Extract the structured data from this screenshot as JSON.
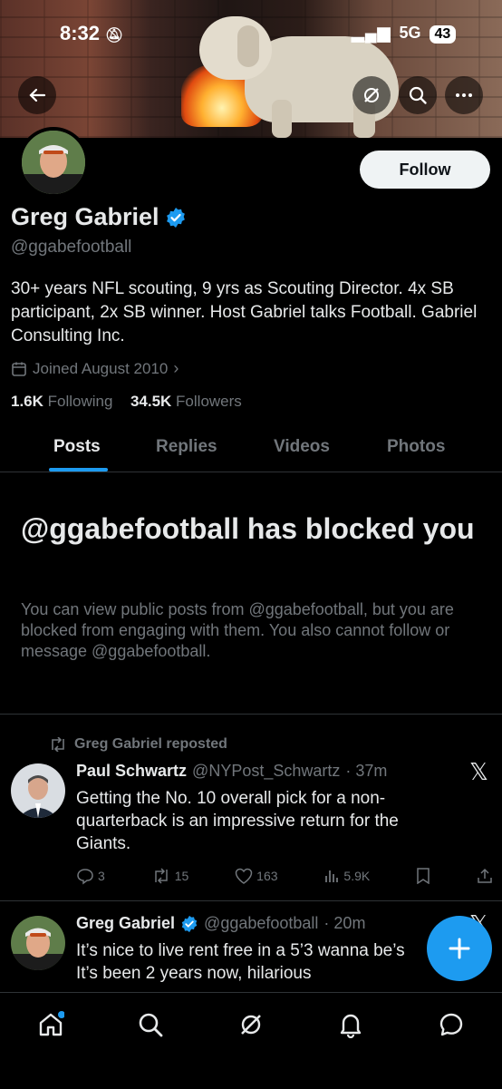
{
  "status": {
    "time": "8:32",
    "network": "5G",
    "battery": "43"
  },
  "profile": {
    "name": "Greg Gabriel",
    "handle": "@ggabefootball",
    "bio": "30+ years NFL scouting, 9 yrs as Scouting Director. 4x SB participant, 2x SB winner. Host Gabriel talks Football. Gabriel Consulting Inc.",
    "joined": "Joined August 2010",
    "following_count": "1.6K",
    "following_label": "Following",
    "followers_count": "34.5K",
    "followers_label": "Followers",
    "follow_label": "Follow"
  },
  "tabs": [
    {
      "label": "Posts"
    },
    {
      "label": "Replies"
    },
    {
      "label": "Videos"
    },
    {
      "label": "Photos"
    }
  ],
  "blocked": {
    "title": "@ggabefootball has blocked you",
    "body": "You can view public posts from @ggabefootball, but you are blocked from engaging with them. You also cannot follow or message @ggabefootball."
  },
  "posts": [
    {
      "repost_label": "Greg Gabriel reposted",
      "author": "Paul Schwartz",
      "handle": "@NYPost_Schwartz",
      "time": "· 37m",
      "text": "Getting the No. 10 overall pick for a non-quarterback is an impressive return for the Giants.",
      "replies": "3",
      "reposts": "15",
      "likes": "163",
      "views": "5.9K"
    },
    {
      "author": "Greg Gabriel",
      "handle": "@ggabefootball",
      "time": "· 20m",
      "text_line1": "It’s nice to live rent free in a 5’3 wanna be’s",
      "text_line2": "It’s been 2 years now, hilarious"
    }
  ],
  "colors": {
    "accent": "#1d9bf0",
    "background": "#000000",
    "muted": "#71767b",
    "text": "#e7e9ea"
  },
  "icons": {
    "back": "back-arrow-icon",
    "grok": "grok-icon",
    "search": "search-icon",
    "more": "more-icon",
    "verified": "verified-badge-icon",
    "calendar": "calendar-icon",
    "repost": "repost-icon",
    "nav": [
      "home-icon",
      "search-icon",
      "grok-icon",
      "notifications-icon",
      "messages-icon"
    ]
  }
}
